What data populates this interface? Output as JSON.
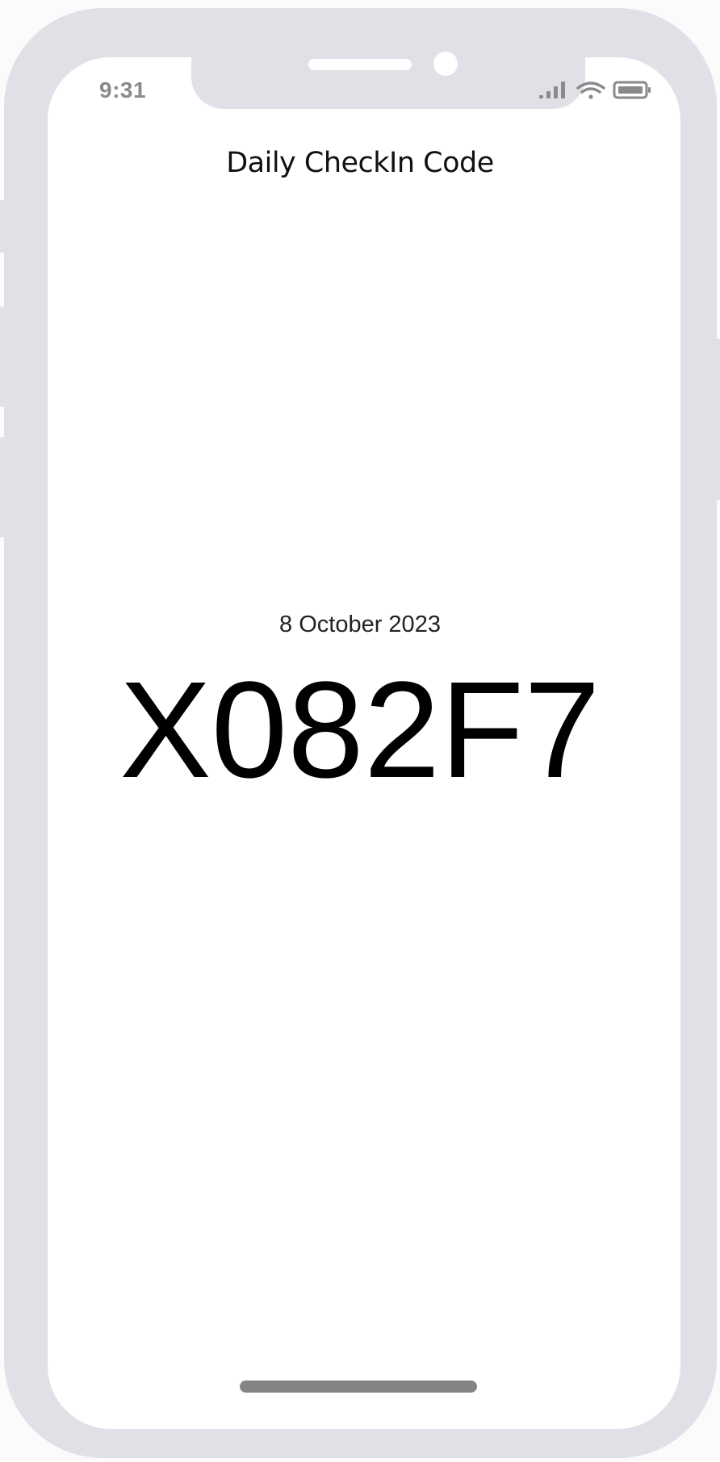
{
  "status_bar": {
    "time": "9:31"
  },
  "page": {
    "title": "Daily CheckIn Code",
    "date": "8 October 2023",
    "code": "X082F7"
  },
  "icons": [
    "signal-icon",
    "wifi-icon",
    "battery-icon"
  ],
  "colors": {
    "device_frame": "#dfe1e6",
    "screen_background": "#ffffff",
    "status_text": "#8a8a8a",
    "home_indicator": "#848484",
    "code_text": "#000000"
  }
}
